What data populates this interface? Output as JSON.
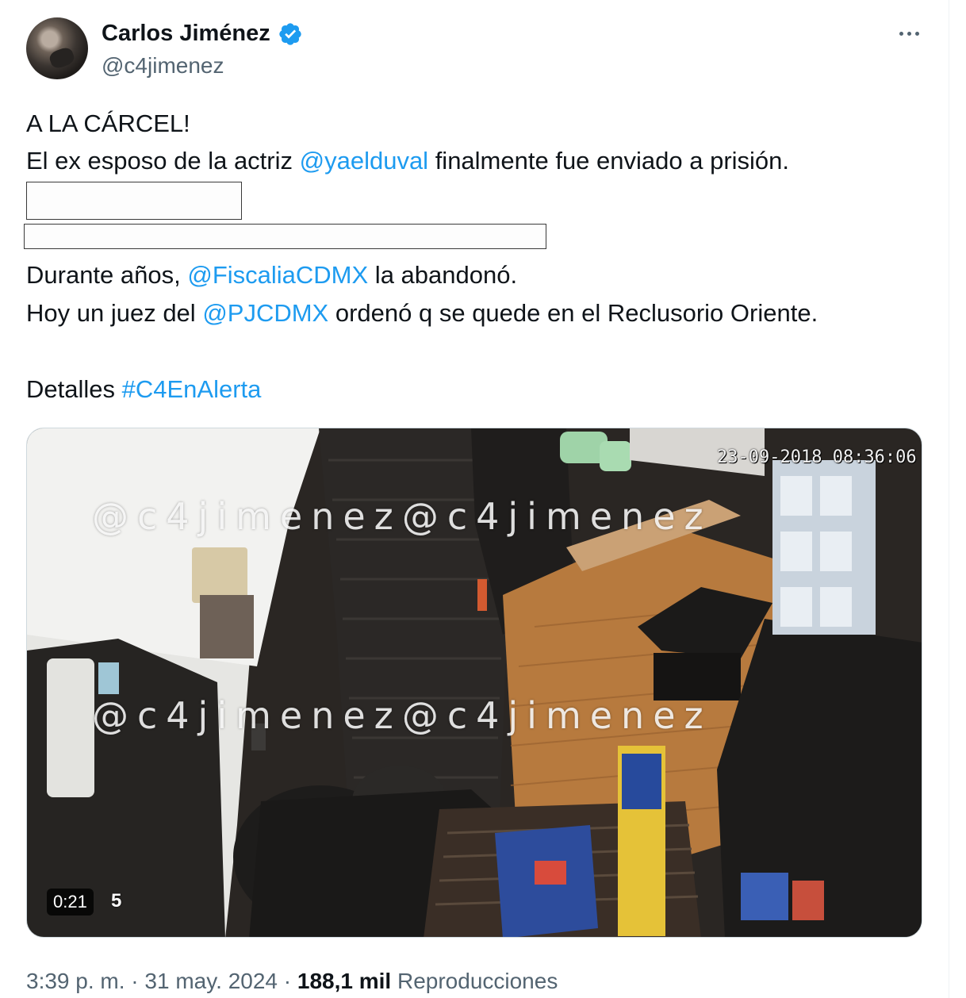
{
  "author": {
    "name": "Carlos Jiménez",
    "handle": "@c4jimenez",
    "verified": true
  },
  "tweet": {
    "line1": "A LA CÁRCEL!",
    "line2": {
      "pre": "El ex esposo de la actriz ",
      "mention": "@yaelduval",
      "post": " finalmente fue enviado a prisión."
    },
    "line5": {
      "pre": "Durante años, ",
      "mention": "@FiscaliaCDMX",
      "post": " la abandonó."
    },
    "line6": {
      "pre": "Hoy un juez del ",
      "mention": "@PJCDMX",
      "post": " ordenó q se quede en el Reclusorio Oriente."
    },
    "line8": {
      "pre": "Detalles ",
      "hashtag": "#C4EnAlerta"
    }
  },
  "media": {
    "camera_timestamp": "23-09-2018 08:36:06",
    "watermark": "@c4jimenez@c4jimenez",
    "duration": "0:21",
    "overlay_fragment": "5"
  },
  "meta": {
    "time": "3:39 p. m.",
    "separator": " · ",
    "date": "31 may. 2024",
    "views_count": "188,1 mil",
    "views_label": "Reproducciones"
  },
  "icons": {
    "verified": "verified-badge-icon",
    "more": "more-options-icon"
  },
  "colors": {
    "link": "#1d9bf0",
    "secondary_text": "#536471",
    "primary_text": "#0f1419"
  }
}
